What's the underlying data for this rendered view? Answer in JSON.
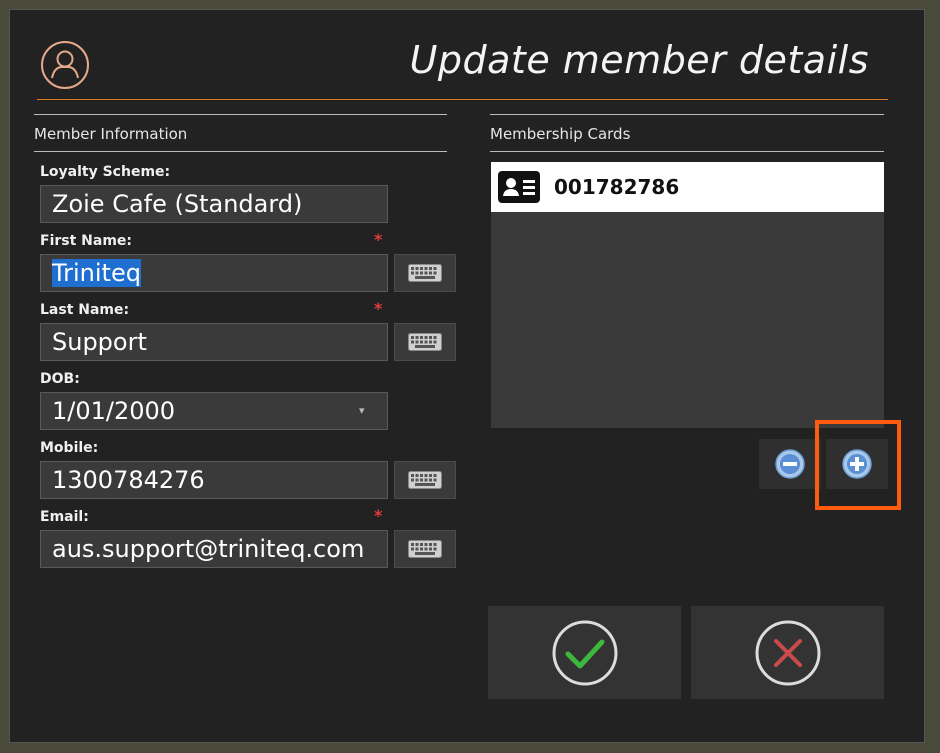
{
  "dialog": {
    "title": "Update member details"
  },
  "member_info": {
    "section_label": "Member Information",
    "fields": {
      "loyalty_scheme": {
        "label": "Loyalty Scheme:",
        "value": "Zoie Cafe (Standard)"
      },
      "first_name": {
        "label": "First Name:",
        "value": "Triniteq",
        "required": "*"
      },
      "last_name": {
        "label": "Last Name:",
        "value": "Support",
        "required": "*"
      },
      "dob": {
        "label": "DOB:",
        "value": "1/01/2000"
      },
      "mobile": {
        "label": "Mobile:",
        "value": "1300784276"
      },
      "email": {
        "label": "Email:",
        "value": "aus.support@triniteq.com",
        "required": "*"
      }
    }
  },
  "membership_cards": {
    "section_label": "Membership Cards",
    "cards": [
      {
        "number": "001782786"
      }
    ]
  },
  "icons": [
    "user-circle-icon",
    "keyboard-icon",
    "id-card-icon",
    "minus-circle-icon",
    "plus-circle-icon",
    "check-icon",
    "close-icon"
  ],
  "colors": {
    "accent_line": "#d9791c",
    "highlight": "#ff5b0f",
    "confirm_check": "#3db83d",
    "cancel_x": "#c94b4b",
    "selection": "#1e6fd0"
  }
}
